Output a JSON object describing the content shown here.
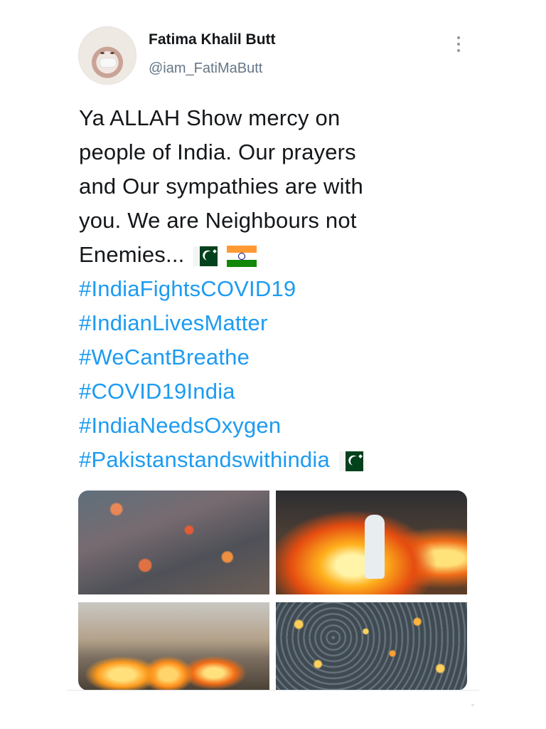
{
  "profile": {
    "name": "Fatima Khalil Butt",
    "handle": "@iam_FatiMaButt"
  },
  "tweet": {
    "lines": [
      "Ya ALLAH Show mercy on",
      "people of India. Our prayers",
      "and Our sympathies are with",
      "you. We are Neighbours not",
      "Enemies..."
    ],
    "hashtags": [
      "#IndiaFightsCOVID19",
      "#IndianLivesMatter",
      "#WeCantBreathe",
      "#COVID19India",
      "#IndiaNeedsOxygen",
      "#Pakistanstandswithindia"
    ]
  },
  "colors": {
    "text": "#14171a",
    "muted": "#657786",
    "hashtag": "#1d9bf0"
  }
}
